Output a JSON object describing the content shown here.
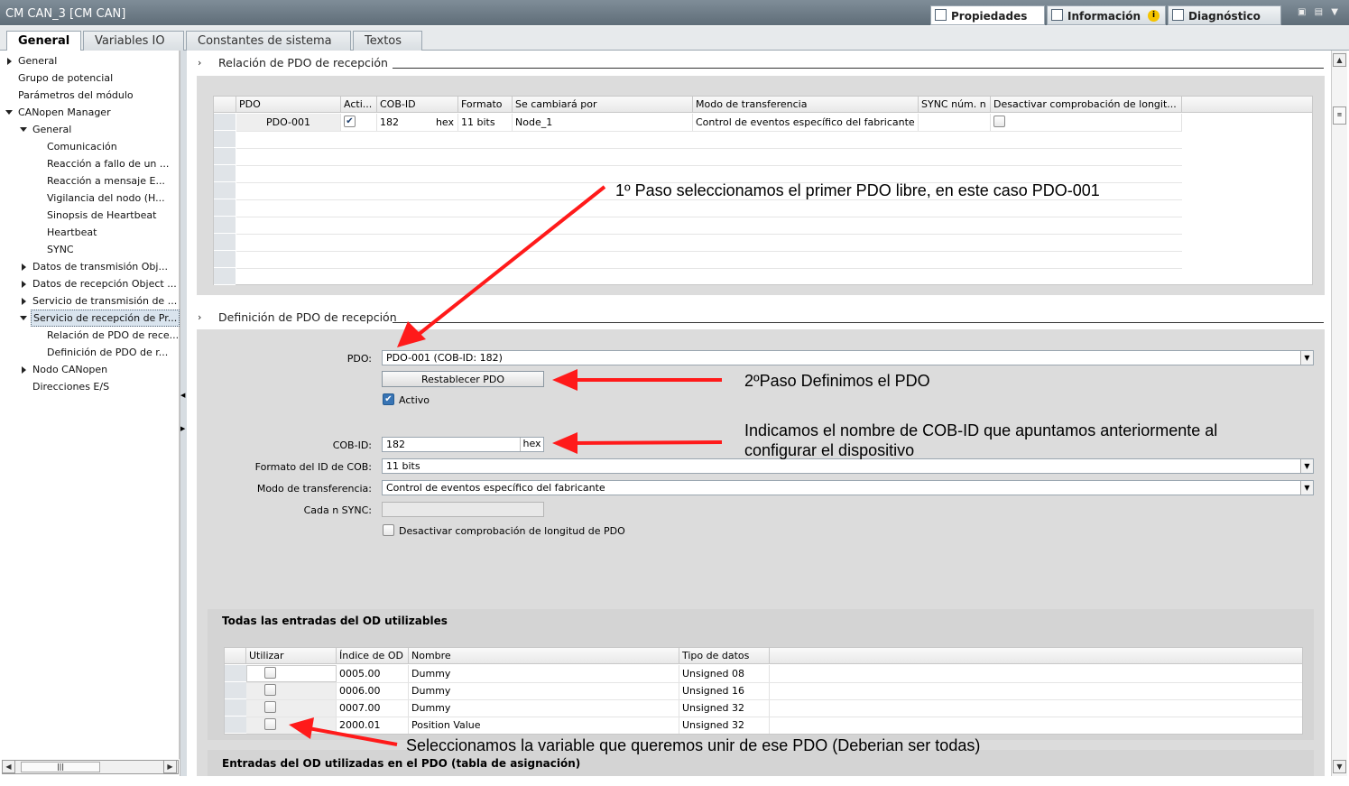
{
  "window": {
    "title": "CM CAN_3 [CM CAN]"
  },
  "top_tabs": {
    "properties": "Propiedades",
    "info": "Información",
    "diagnostics": "Diagnóstico",
    "info_badge": "i"
  },
  "tabs": [
    "General",
    "Variables IO",
    "Constantes de sistema",
    "Textos"
  ],
  "nav": {
    "items": [
      {
        "label": "General"
      },
      {
        "label": "Grupo de potencial"
      },
      {
        "label": "Parámetros del módulo"
      },
      {
        "label": "CANopen Manager"
      },
      {
        "label": "General"
      },
      {
        "label": "Comunicación"
      },
      {
        "label": "Reacción a fallo de un ..."
      },
      {
        "label": "Reacción a mensaje E..."
      },
      {
        "label": "Vigilancia del nodo (H..."
      },
      {
        "label": "Sinopsis de Heartbeat"
      },
      {
        "label": "Heartbeat"
      },
      {
        "label": "SYNC"
      },
      {
        "label": "Datos de transmisión Obj..."
      },
      {
        "label": "Datos de recepción Object ..."
      },
      {
        "label": "Servicio de transmisión de ..."
      },
      {
        "label": "Servicio de recepción de Pr..."
      },
      {
        "label": "Relación de PDO de rece..."
      },
      {
        "label": "Definición de PDO de r..."
      },
      {
        "label": "Nodo CANopen"
      },
      {
        "label": "Direcciones E/S"
      }
    ]
  },
  "section1": {
    "title": "Relación de PDO de recepción",
    "headers": [
      "PDO",
      "Acti...",
      "COB-ID",
      "Formato",
      "Se cambiará por",
      "Modo de transferencia",
      "SYNC núm. n",
      "Desactivar comprobación de longit..."
    ],
    "row": {
      "pdo": "PDO-001",
      "cob_id": "182",
      "hex": "hex",
      "format": "11 bits",
      "replaced_by": "Node_1",
      "mode": "Control de eventos específico del fabricante"
    }
  },
  "section2": {
    "title": "Definición de PDO de recepción",
    "pdo_label": "PDO:",
    "pdo_value": "PDO-001 (COB-ID: 182)",
    "reset_button": "Restablecer PDO",
    "active_label": "Activo",
    "cob_label": "COB-ID:",
    "cob_value": "182",
    "cob_hex": "hex",
    "format_label": "Formato del ID de COB:",
    "format_value": "11 bits",
    "mode_label": "Modo de transferencia:",
    "mode_value": "Control de eventos específico del fabricante",
    "sync_label": "Cada n SYNC:",
    "sync_value": "",
    "disable_label": "Desactivar comprobación de longitud de PDO"
  },
  "od": {
    "title": "Todas las entradas del OD utilizables",
    "headers": [
      "Utilizar",
      "Índice de OD",
      "Nombre",
      "Tipo de datos"
    ],
    "rows": [
      {
        "index": "0005.00",
        "name": "Dummy",
        "type": "Unsigned 08"
      },
      {
        "index": "0006.00",
        "name": "Dummy",
        "type": "Unsigned 16"
      },
      {
        "index": "0007.00",
        "name": "Dummy",
        "type": "Unsigned 32"
      },
      {
        "index": "2000.01",
        "name": "Position Value",
        "type": "Unsigned 32"
      }
    ],
    "footer_title": "Entradas del OD utilizadas en el PDO (tabla de asignación)"
  },
  "annotations": {
    "step1": "1º Paso seleccionamos el primer PDO libre, en este caso PDO-001",
    "step2": "2ºPaso Definimos el PDO",
    "cob_line1": "Indicamos el nombre de COB-ID que apuntamos anteriormente al",
    "cob_line2": "configurar el dispositivo",
    "variable": "Seleccionamos la variable que queremos unir de ese PDO (Deberian ser todas)"
  },
  "colors": {
    "titlebar": "#6f7d88",
    "arrow": "#ff1a1a",
    "selected_nav": "#d9e4ee",
    "panel": "#dcdcdc"
  }
}
